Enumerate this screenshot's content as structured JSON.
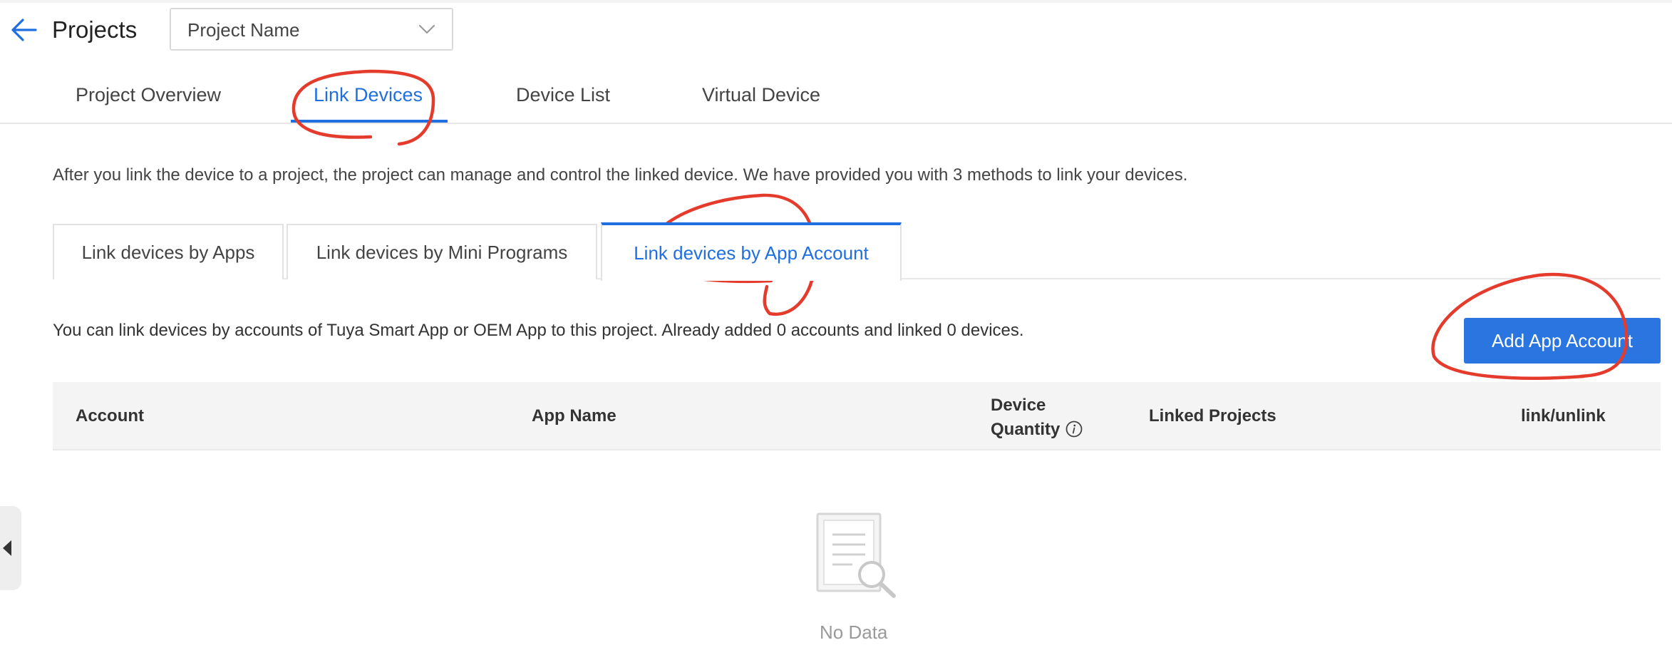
{
  "header": {
    "title": "Projects",
    "project_select": {
      "value": "Project Name"
    }
  },
  "top_tabs": [
    {
      "label": "Project Overview",
      "active": false
    },
    {
      "label": "Link Devices",
      "active": true
    },
    {
      "label": "Device List",
      "active": false
    },
    {
      "label": "Virtual Device",
      "active": false
    }
  ],
  "intro": "After you link the device to a project, the project can manage and control the linked device. We have provided you with 3 methods to link your devices.",
  "method_tabs": [
    {
      "label": "Link devices by Apps",
      "active": false
    },
    {
      "label": "Link devices by Mini Programs",
      "active": false
    },
    {
      "label": "Link devices by App Account",
      "active": true
    }
  ],
  "account_info": "You can link devices by accounts of Tuya Smart App or OEM App to this project. Already added 0 accounts and linked 0 devices.",
  "add_button_label": "Add App Account",
  "table": {
    "columns": {
      "account": "Account",
      "app_name": "App Name",
      "device_quantity_line1": "Device",
      "device_quantity_line2": "Quantity",
      "linked_projects": "Linked Projects",
      "link_unlink": "link/unlink"
    },
    "rows": [],
    "empty_text": "No Data"
  },
  "colors": {
    "accent": "#1f6fe0",
    "button": "#2a75e0",
    "annotation": "#e53b2c"
  },
  "icons": {
    "back": "back-arrow-icon",
    "dropdown": "chevron-down-icon",
    "info": "info-icon",
    "empty": "empty-document-search-icon",
    "collapse": "caret-left-icon"
  }
}
